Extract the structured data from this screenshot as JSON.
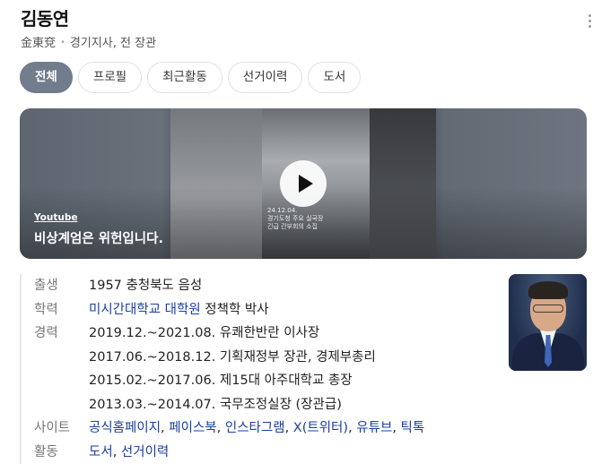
{
  "profile": {
    "name": "김동연",
    "hanja": "金東兗",
    "role": "경기지사, 전 장관"
  },
  "tabs": [
    {
      "label": "전체",
      "active": true
    },
    {
      "label": "프로필",
      "active": false
    },
    {
      "label": "최근활동",
      "active": false
    },
    {
      "label": "선거이력",
      "active": false
    },
    {
      "label": "도서",
      "active": false
    }
  ],
  "video": {
    "source": "Youtube",
    "title": "비상계엄은 위헌입니다.",
    "caption_line1": "24.12.04.",
    "caption_line2": "경기도청 주요 실국장",
    "caption_line3": "긴급 간부회의 소집",
    "icon": "play-icon"
  },
  "info": {
    "birth": {
      "label": "출생",
      "value": "1957 충청북도 음성"
    },
    "education": {
      "label": "학력",
      "link": "미시간대학교 대학원",
      "rest": " 정책학 박사"
    },
    "career": {
      "label": "경력",
      "items": [
        "2019.12.~2021.08. 유쾌한반란 이사장",
        "2017.06.~2018.12. 기획재정부 장관, 경제부총리",
        "2015.02.~2017.06. 제15대 아주대학교 총장",
        "2013.03.~2014.07. 국무조정실장 (장관급)"
      ]
    },
    "sites": {
      "label": "사이트",
      "links": [
        "공식홈페이지",
        "페이스북",
        "인스타그램",
        "X(트위터)",
        "유튜브",
        "틱톡"
      ]
    },
    "activity": {
      "label": "활동",
      "links": [
        "도서",
        "선거이력"
      ]
    },
    "separator": ", "
  },
  "icons": {
    "more": "more-vertical-icon"
  }
}
